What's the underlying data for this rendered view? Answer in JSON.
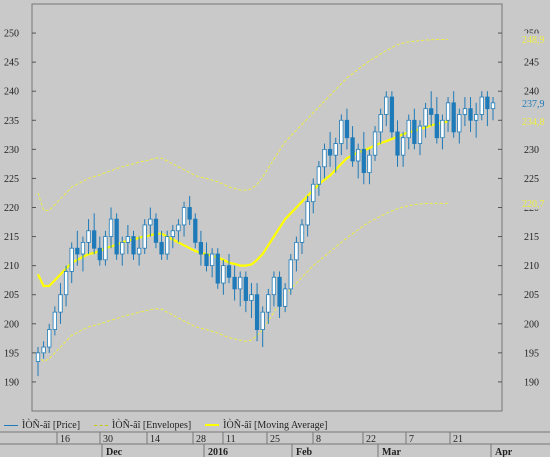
{
  "chart_data": {
    "type": "candlestick",
    "y_axis": {
      "min": 185,
      "max": 255,
      "ticks": [
        "190",
        "195",
        "200",
        "205",
        "210",
        "215",
        "220",
        "225",
        "230",
        "235",
        "240",
        "245",
        "250"
      ],
      "tick_values": [
        190,
        195,
        200,
        205,
        210,
        215,
        220,
        225,
        230,
        235,
        240,
        245,
        250
      ]
    },
    "x_day_ticks": [
      "16",
      "30",
      "14",
      "28",
      "11",
      "25",
      "8",
      "22",
      "7",
      "21"
    ],
    "x_month_labels": [
      "Dec",
      "2016",
      "Feb",
      "Mar",
      "Apr"
    ],
    "right_labels": [
      {
        "text": "248,9",
        "value": 248.9,
        "color": "#eeee44"
      },
      {
        "text": "237,9",
        "value": 237.9,
        "color": "#1e7ab8"
      },
      {
        "text": "234,8",
        "value": 234.8,
        "color": "#eeee44"
      },
      {
        "text": "220,7",
        "value": 220.7,
        "color": "#eeee44"
      }
    ],
    "legend": [
      {
        "label": "ÌÒÑ-ãî [Price]",
        "color": "#1e7ab8",
        "style": "solid"
      },
      {
        "label": "ÌÒÑ-ãî [Envelopes]",
        "color": "#eeee44",
        "style": "dashed"
      },
      {
        "label": "ÌÒÑ-ãî [Moving Average]",
        "color": "#ffff00",
        "style": "solid"
      }
    ],
    "colors": {
      "up": "#ffffff",
      "down": "#1e7ab8",
      "wick": "#1e7ab8",
      "ma": "#ffff00",
      "envelope": "#eeee44"
    },
    "candles": [
      [
        193.5,
        196,
        191,
        195
      ],
      [
        195,
        197,
        194,
        196
      ],
      [
        196,
        200,
        195,
        199
      ],
      [
        199,
        203,
        198,
        202
      ],
      [
        202,
        207,
        200,
        205
      ],
      [
        205,
        210,
        203,
        209
      ],
      [
        209,
        214,
        207,
        213
      ],
      [
        213,
        216,
        210,
        212
      ],
      [
        212,
        215,
        209,
        214
      ],
      [
        214,
        218,
        212,
        216
      ],
      [
        216,
        219,
        212,
        213
      ],
      [
        213,
        215,
        210,
        211
      ],
      [
        211,
        216,
        210,
        215
      ],
      [
        215,
        220,
        213,
        218
      ],
      [
        218,
        219,
        211,
        212
      ],
      [
        212,
        215,
        210,
        214
      ],
      [
        214,
        217,
        212,
        215
      ],
      [
        215,
        216,
        211,
        212
      ],
      [
        212,
        215,
        210,
        213
      ],
      [
        213,
        218,
        212,
        217
      ],
      [
        217,
        220,
        215,
        218
      ],
      [
        218,
        219,
        213,
        214
      ],
      [
        214,
        216,
        211,
        212
      ],
      [
        212,
        216,
        211,
        215
      ],
      [
        215,
        217,
        213,
        216
      ],
      [
        216,
        218,
        214,
        217
      ],
      [
        217,
        221,
        215,
        220
      ],
      [
        220,
        222,
        217,
        218
      ],
      [
        218,
        219,
        213,
        214
      ],
      [
        214,
        216,
        210,
        212
      ],
      [
        212,
        214,
        209,
        210
      ],
      [
        210,
        213,
        208,
        212
      ],
      [
        212,
        213,
        206,
        207
      ],
      [
        207,
        211,
        205,
        210
      ],
      [
        210,
        212,
        207,
        208
      ],
      [
        208,
        210,
        204,
        206
      ],
      [
        206,
        209,
        203,
        208
      ],
      [
        208,
        209,
        202,
        204
      ],
      [
        204,
        207,
        201,
        205
      ],
      [
        205,
        207,
        197,
        199
      ],
      [
        199,
        203,
        196,
        202
      ],
      [
        202,
        206,
        200,
        205
      ],
      [
        205,
        209,
        203,
        208
      ],
      [
        208,
        209,
        201,
        203
      ],
      [
        203,
        207,
        202,
        206
      ],
      [
        206,
        212,
        205,
        211
      ],
      [
        211,
        215,
        209,
        214
      ],
      [
        214,
        218,
        212,
        217
      ],
      [
        217,
        222,
        215,
        221
      ],
      [
        221,
        225,
        219,
        224
      ],
      [
        224,
        228,
        222,
        227
      ],
      [
        227,
        231,
        225,
        230
      ],
      [
        230,
        233,
        227,
        229
      ],
      [
        229,
        232,
        226,
        231
      ],
      [
        231,
        236,
        229,
        235
      ],
      [
        235,
        237,
        230,
        232
      ],
      [
        232,
        234,
        227,
        228
      ],
      [
        228,
        231,
        225,
        230
      ],
      [
        230,
        233,
        224,
        226
      ],
      [
        226,
        230,
        224,
        229
      ],
      [
        229,
        234,
        228,
        233
      ],
      [
        233,
        237,
        231,
        236
      ],
      [
        236,
        240,
        234,
        239
      ],
      [
        239,
        240,
        232,
        233
      ],
      [
        233,
        235,
        227,
        229
      ],
      [
        229,
        233,
        227,
        232
      ],
      [
        232,
        236,
        230,
        235
      ],
      [
        235,
        237,
        230,
        231
      ],
      [
        231,
        235,
        229,
        234
      ],
      [
        234,
        238,
        232,
        237
      ],
      [
        237,
        240,
        234,
        236
      ],
      [
        236,
        239,
        231,
        232
      ],
      [
        232,
        236,
        230,
        235
      ],
      [
        235,
        239,
        233,
        238
      ],
      [
        238,
        240,
        232,
        233
      ],
      [
        233,
        237,
        231,
        236
      ],
      [
        236,
        239,
        234,
        237
      ],
      [
        237,
        239,
        233,
        235
      ],
      [
        235,
        238,
        232,
        236
      ],
      [
        236,
        240,
        235,
        239
      ],
      [
        239,
        240,
        234,
        237
      ],
      [
        237,
        239,
        235,
        238
      ]
    ],
    "moving_average": [
      208.5,
      206.5,
      206.5,
      207.5,
      208.5,
      209.5,
      210.5,
      211,
      211.5,
      212,
      212.2,
      212.5,
      213,
      213.3,
      213.6,
      214,
      214.3,
      214.5,
      214.8,
      215,
      215.2,
      215.5,
      215.5,
      215,
      214.5,
      214,
      213.5,
      213,
      212.5,
      212.2,
      212,
      211.7,
      211.4,
      211,
      210.5,
      210.3,
      210,
      210,
      210.2,
      211,
      212,
      213.5,
      215,
      216.5,
      218,
      219,
      220,
      221,
      222,
      223,
      224,
      224.8,
      225.5,
      226.5,
      227.5,
      228.5,
      229,
      229.5,
      229.8,
      230.2,
      230.7,
      231.1,
      231.4,
      231.8,
      232.2,
      232.6,
      232.9,
      233.2,
      233.5,
      233.8,
      234.1,
      234.4,
      234.6,
      234.8
    ],
    "envelope_upper": [
      222.5,
      219.5,
      219.5,
      220.5,
      221.5,
      222.5,
      223.5,
      224,
      224.5,
      225,
      225.3,
      225.6,
      226,
      226.3,
      226.7,
      227,
      227.3,
      227.5,
      227.8,
      228,
      228.2,
      228.5,
      228.5,
      228,
      227.5,
      227,
      226.5,
      226,
      225.5,
      225.2,
      225,
      224.7,
      224.4,
      224,
      223.5,
      223.3,
      223,
      223,
      223.2,
      224,
      225.2,
      226.8,
      228.3,
      229.8,
      231.3,
      232.3,
      233.3,
      234.3,
      235.3,
      236.3,
      237.3,
      238.3,
      239.3,
      240.3,
      241.3,
      242.3,
      243,
      243.8,
      244.5,
      245.2,
      245.8,
      246.4,
      247,
      247.5,
      248,
      248.3,
      248.5,
      248.6,
      248.7,
      248.8,
      248.85,
      248.9,
      248.9,
      248.9
    ],
    "envelope_lower": [
      194.5,
      193.5,
      194,
      195,
      196,
      197,
      198,
      198.5,
      199,
      199.5,
      199.7,
      200,
      200.3,
      200.6,
      200.9,
      201.2,
      201.5,
      201.7,
      202,
      202.2,
      202.4,
      202.6,
      202.5,
      202,
      201.5,
      201,
      200.5,
      200,
      199.5,
      199.2,
      199,
      198.7,
      198.4,
      198,
      197.6,
      197.4,
      197.2,
      197,
      197.2,
      198,
      199,
      200.5,
      202,
      203.5,
      205,
      206,
      207,
      208,
      209,
      210,
      210.8,
      211.6,
      212.4,
      213.2,
      214,
      214.8,
      215.5,
      216.2,
      216.9,
      217.5,
      218,
      218.5,
      219,
      219.4,
      219.8,
      220.1,
      220.3,
      220.5,
      220.6,
      220.7,
      220.7,
      220.7,
      220.7,
      220.7
    ]
  }
}
